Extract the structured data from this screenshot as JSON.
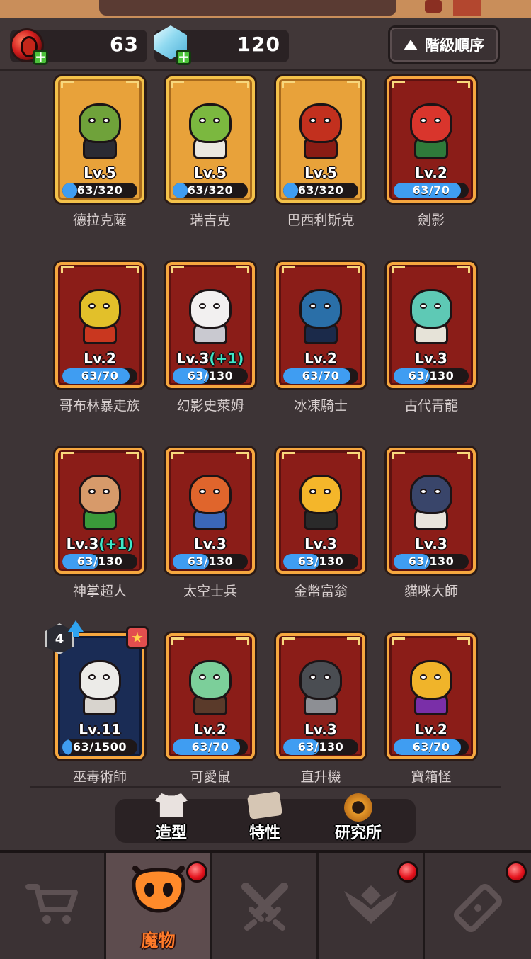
{
  "resources": {
    "red_gem": {
      "value": "63",
      "icon": "red-gem-icon"
    },
    "crystal": {
      "value": "120",
      "icon": "crystal-icon"
    }
  },
  "sort_button": {
    "label": "階級順序",
    "icon": "triangle-up-icon"
  },
  "monsters": [
    {
      "name": "德拉克薩",
      "level": "Lv.5",
      "bonus": "",
      "xp": "63/320",
      "progress": 0.197,
      "frame": "gold",
      "head_color": "#6fa23a",
      "body_color": "#2b2b33"
    },
    {
      "name": "瑞吉克",
      "level": "Lv.5",
      "bonus": "",
      "xp": "63/320",
      "progress": 0.197,
      "frame": "gold",
      "head_color": "#7bb83f",
      "body_color": "#eae7e0"
    },
    {
      "name": "巴西利斯克",
      "level": "Lv.5",
      "bonus": "",
      "xp": "63/320",
      "progress": 0.197,
      "frame": "gold",
      "head_color": "#c2301e",
      "body_color": "#8a1c14"
    },
    {
      "name": "劍影",
      "level": "Lv.2",
      "bonus": "",
      "xp": "63/70",
      "progress": 0.9,
      "frame": "red",
      "head_color": "#d9352c",
      "body_color": "#2f7a3a"
    },
    {
      "name": "哥布林暴走族",
      "level": "Lv.2",
      "bonus": "",
      "xp": "63/70",
      "progress": 0.9,
      "frame": "red",
      "head_color": "#e2c02a",
      "body_color": "#c9371f"
    },
    {
      "name": "幻影史萊姆",
      "level": "Lv.3",
      "bonus": "(+1)",
      "xp": "63/130",
      "progress": 0.485,
      "frame": "red",
      "head_color": "#f2f0f0",
      "body_color": "#c9c9d0"
    },
    {
      "name": "冰凍騎士",
      "level": "Lv.2",
      "bonus": "",
      "xp": "63/70",
      "progress": 0.9,
      "frame": "red",
      "head_color": "#2a6fa8",
      "body_color": "#1b2a4a"
    },
    {
      "name": "古代青龍",
      "level": "Lv.3",
      "bonus": "",
      "xp": "63/130",
      "progress": 0.485,
      "frame": "red",
      "head_color": "#5ec9b5",
      "body_color": "#e6e3d8"
    },
    {
      "name": "神掌超人",
      "level": "Lv.3",
      "bonus": "(+1)",
      "xp": "63/130",
      "progress": 0.485,
      "frame": "red",
      "head_color": "#d79a6a",
      "body_color": "#3a9a3a"
    },
    {
      "name": "太空士兵",
      "level": "Lv.3",
      "bonus": "",
      "xp": "63/130",
      "progress": 0.485,
      "frame": "red",
      "head_color": "#e0652c",
      "body_color": "#3b67b8"
    },
    {
      "name": "金幣富翁",
      "level": "Lv.3",
      "bonus": "",
      "xp": "63/130",
      "progress": 0.485,
      "frame": "red",
      "head_color": "#f4b62a",
      "body_color": "#2a2a2a"
    },
    {
      "name": "貓咪大師",
      "level": "Lv.3",
      "bonus": "",
      "xp": "63/130",
      "progress": 0.485,
      "frame": "red",
      "head_color": "#39456a",
      "body_color": "#e9e4dc"
    },
    {
      "name": "巫毒術師",
      "level": "Lv.11",
      "bonus": "",
      "xp": "63/1500",
      "progress": 0.042,
      "frame": "blue",
      "head_color": "#ecebe8",
      "body_color": "#d8d4ce",
      "count_badge": "4",
      "has_upgrade_arrow": true,
      "has_star_badge": true
    },
    {
      "name": "可愛鼠",
      "level": "Lv.2",
      "bonus": "",
      "xp": "63/70",
      "progress": 0.9,
      "frame": "red",
      "head_color": "#7ccf9a",
      "body_color": "#5a3a2a"
    },
    {
      "name": "直升機",
      "level": "Lv.3",
      "bonus": "",
      "xp": "63/130",
      "progress": 0.485,
      "frame": "red",
      "head_color": "#4a4d52",
      "body_color": "#8d8f94"
    },
    {
      "name": "寶箱怪",
      "level": "Lv.2",
      "bonus": "",
      "xp": "63/70",
      "progress": 0.9,
      "frame": "red",
      "head_color": "#f0b42a",
      "body_color": "#7a2fa8"
    }
  ],
  "sub_tabs": [
    {
      "label": "造型",
      "icon": "shirt-icon"
    },
    {
      "label": "特性",
      "icon": "scroll-icon"
    },
    {
      "label": "研究所",
      "icon": "cog-icon"
    }
  ],
  "bottom_nav": [
    {
      "label": "",
      "icon": "shop-cart-icon",
      "active": false,
      "has_notification": false
    },
    {
      "label": "魔物",
      "icon": "monster-face-icon",
      "active": true,
      "has_notification": true
    },
    {
      "label": "",
      "icon": "crossed-swords-icon",
      "active": false,
      "has_notification": false
    },
    {
      "label": "",
      "icon": "rank-wings-icon",
      "active": false,
      "has_notification": true
    },
    {
      "label": "",
      "icon": "ticket-icon",
      "active": false,
      "has_notification": true
    }
  ]
}
